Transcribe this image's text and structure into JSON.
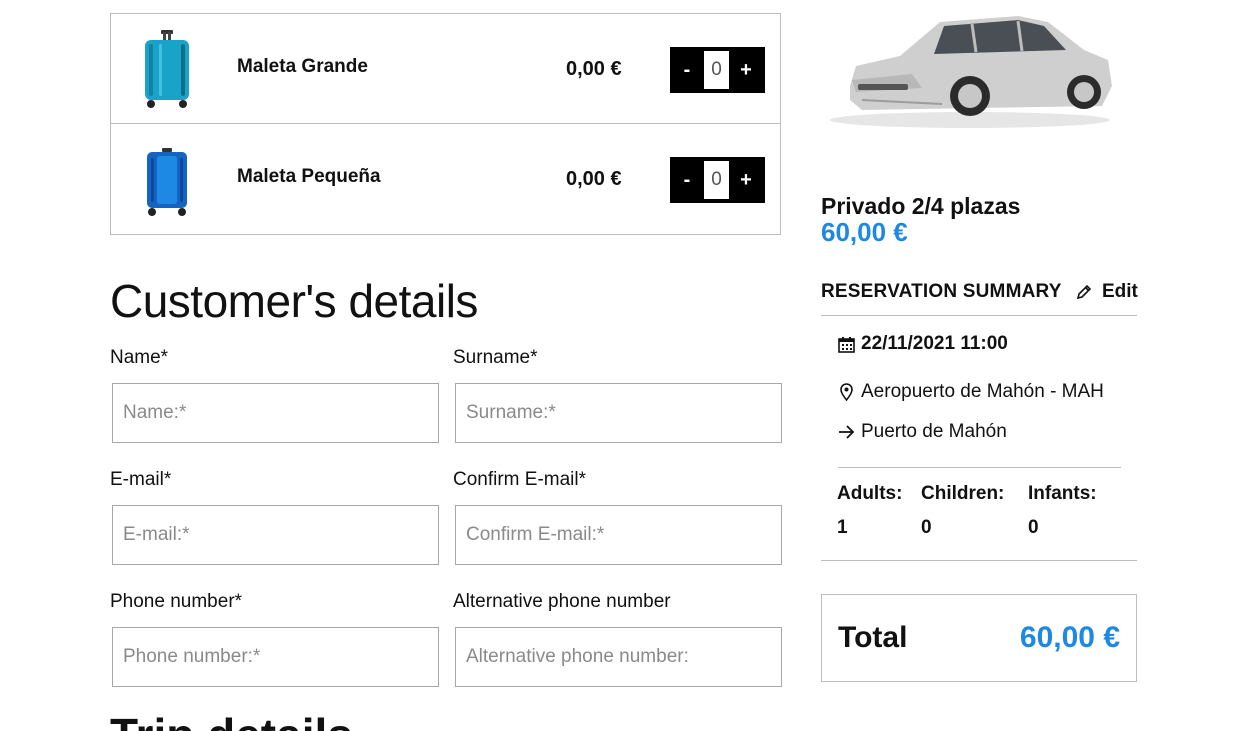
{
  "luggage": {
    "items": [
      {
        "name": "Maleta Grande",
        "price": "0,00 €",
        "quantity": "0",
        "color": "#1aa3c9"
      },
      {
        "name": "Maleta Pequeña",
        "price": "0,00 €",
        "quantity": "0",
        "color": "#1565c0"
      }
    ],
    "minus_label": "-",
    "plus_label": "+"
  },
  "customer": {
    "title": "Customer's details",
    "fields": {
      "name": {
        "label": "Name*",
        "placeholder": "Name:*"
      },
      "surname": {
        "label": "Surname*",
        "placeholder": "Surname:*"
      },
      "email": {
        "label": "E-mail*",
        "placeholder": "E-mail:*"
      },
      "confirm_email": {
        "label": "Confirm E-mail*",
        "placeholder": "Confirm E-mail:*"
      },
      "phone": {
        "label": "Phone number*",
        "placeholder": "Phone number:*"
      },
      "alt_phone": {
        "label": "Alternative phone number",
        "placeholder": "Alternative phone number:"
      }
    }
  },
  "trip": {
    "title": "Trip details"
  },
  "service": {
    "name": "Privado 2/4 plazas",
    "price": "60,00 €"
  },
  "summary": {
    "title": "RESERVATION SUMMARY",
    "edit_label": "Edit",
    "datetime": "22/11/2021 11:00",
    "origin": "Aeropuerto de Mahón - MAH",
    "destination": "Puerto de Mahón",
    "adults_label": "Adults:",
    "adults": "1",
    "children_label": "Children:",
    "children": "0",
    "infants_label": "Infants:",
    "infants": "0"
  },
  "total": {
    "label": "Total",
    "value": "60,00 €"
  },
  "colors": {
    "accent": "#1e88e5"
  }
}
